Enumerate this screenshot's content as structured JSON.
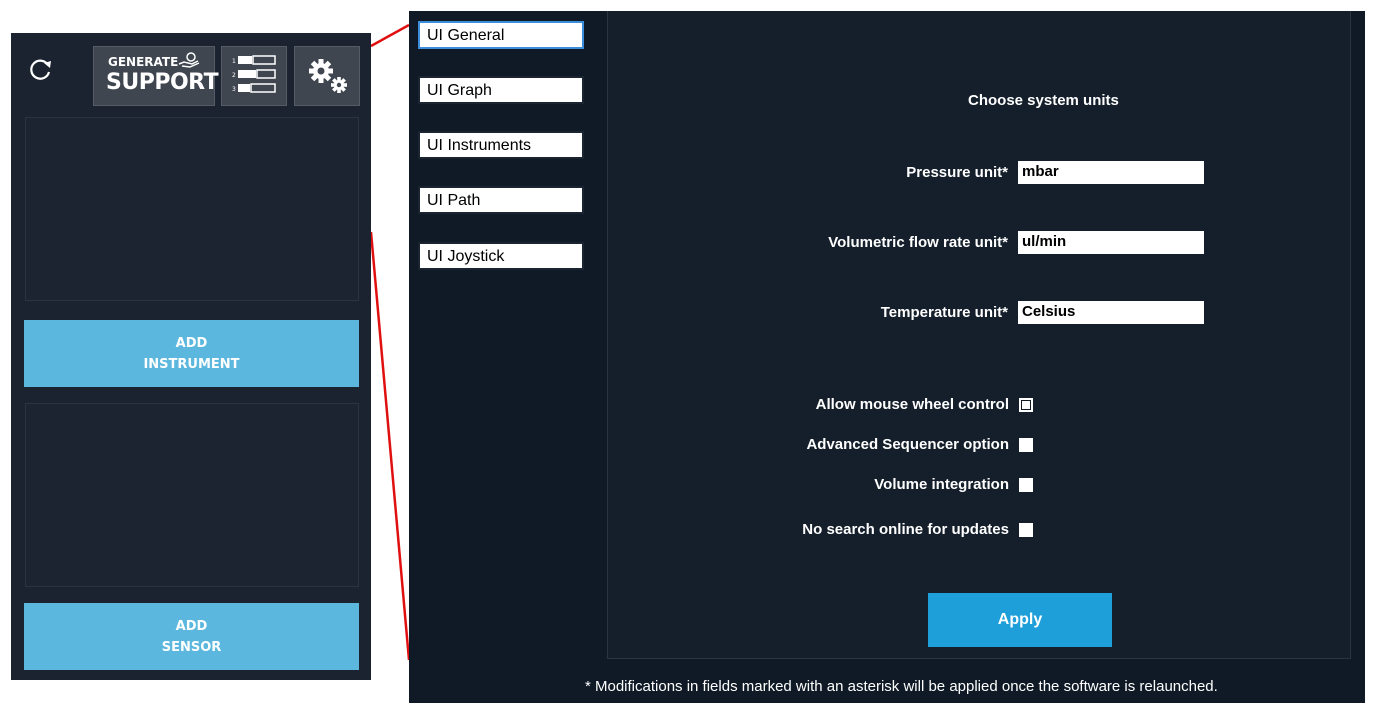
{
  "toolbar": {
    "refresh_icon": "refresh-icon",
    "support_line1": "GENERATE",
    "support_line2": "SUPPORT",
    "sequence_icon": "sequence-list-icon",
    "settings_icon": "gears-icon"
  },
  "left_panel": {
    "add_instrument_line1": "ADD",
    "add_instrument_line2": "INSTRUMENT",
    "add_sensor_line1": "ADD",
    "add_sensor_line2": "SENSOR"
  },
  "tabs": [
    {
      "label": "UI General",
      "active": true
    },
    {
      "label": "UI Graph",
      "active": false
    },
    {
      "label": "UI Instruments",
      "active": false
    },
    {
      "label": "UI Path",
      "active": false
    },
    {
      "label": "UI Joystick",
      "active": false
    }
  ],
  "settings": {
    "heading": "Choose system units",
    "pressure_label": "Pressure unit*",
    "pressure_value": "mbar",
    "flow_label": "Volumetric flow rate unit*",
    "flow_value": "ul/min",
    "temperature_label": "Temperature unit*",
    "temperature_value": "Celsius",
    "options": [
      {
        "label": "Allow mouse wheel control",
        "checked": false
      },
      {
        "label": "Advanced Sequencer option",
        "checked": false
      },
      {
        "label": "Volume integration",
        "checked": false
      },
      {
        "label": "No search online for updates",
        "checked": false
      }
    ],
    "apply_label": "Apply",
    "footnote": "* Modifications in fields marked with an asterisk will be applied once the software is relaunched."
  },
  "colors": {
    "panel_bg": "#1b2330",
    "settings_bg": "#0f1a26",
    "add_button": "#5bb7dd",
    "apply_button": "#1e9fd9",
    "callout_line": "#e01010",
    "active_tab_border": "#3c8edc"
  }
}
